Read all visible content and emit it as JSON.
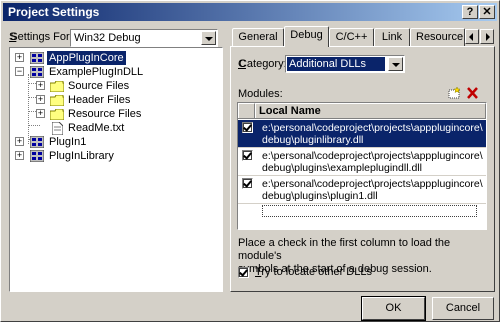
{
  "window": {
    "title": "Project Settings",
    "help_label": "?",
    "close_label": "✕"
  },
  "left": {
    "settings_for_label": "Settings For:",
    "settings_for_value": "Win32 Debug",
    "tree": {
      "nodes": [
        {
          "label": "AppPlugInCore",
          "expander": "+"
        },
        {
          "label": "ExamplePlugInDLL",
          "expander": "−"
        },
        {
          "label": "Source Files",
          "expander": "+"
        },
        {
          "label": "Header Files",
          "expander": "+"
        },
        {
          "label": "Resource Files",
          "expander": "+"
        },
        {
          "label": "ReadMe.txt"
        },
        {
          "label": "PlugIn1",
          "expander": "+"
        },
        {
          "label": "PlugInLibrary",
          "expander": "+"
        }
      ]
    }
  },
  "tabs": [
    {
      "label": "General"
    },
    {
      "label": "Debug"
    },
    {
      "label": "C/C++"
    },
    {
      "label": "Link"
    },
    {
      "label": "Resource"
    }
  ],
  "debug": {
    "category_label": "Category:",
    "category_value": "Additional DLLs",
    "modules_label": "Modules:",
    "column_header": "Local Name",
    "modules": [
      {
        "line1": "e:\\personal\\codeproject\\projects\\appplugincore\\",
        "line2": "debug\\pluginlibrary.dll",
        "checked": true
      },
      {
        "line1": "e:\\personal\\codeproject\\projects\\appplugincore\\",
        "line2": "debug\\plugins\\exampleplugindll.dll",
        "checked": true
      },
      {
        "line1": "e:\\personal\\codeproject\\projects\\appplugincore\\",
        "line2": "debug\\plugins\\plugin1.dll",
        "checked": true
      }
    ],
    "help_text_1": "Place a check in the first column to load the module's",
    "help_text_2": "symbols at the start of a debug session.",
    "try_locate_label": "ry to locate other DLLs",
    "try_locate_accel": "T",
    "try_locate_checked": true
  },
  "buttons": {
    "ok": "OK",
    "cancel": "Cancel"
  },
  "colors": {
    "title_start": "#0a246a",
    "title_end": "#a6caf0",
    "selection": "#0a246a",
    "face": "#d4d0c8"
  }
}
